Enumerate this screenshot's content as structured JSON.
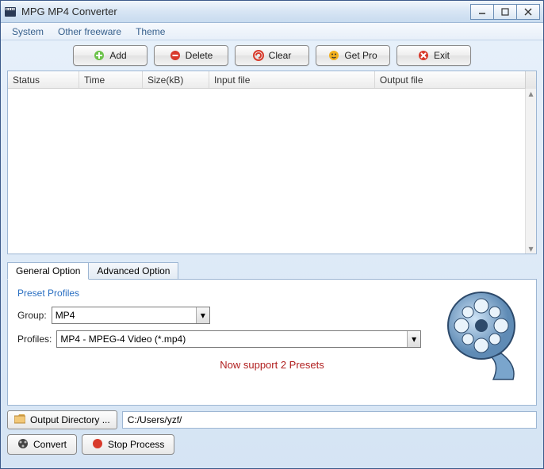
{
  "window": {
    "title": "MPG MP4 Converter"
  },
  "menu": {
    "system": "System",
    "other": "Other freeware",
    "theme": "Theme"
  },
  "toolbar": {
    "add": "Add",
    "delete": "Delete",
    "clear": "Clear",
    "getpro": "Get Pro",
    "exit": "Exit"
  },
  "table": {
    "columns": {
      "status": "Status",
      "time": "Time",
      "size": "Size(kB)",
      "input": "Input file",
      "output": "Output file"
    },
    "rows": []
  },
  "tabs": {
    "general": "General Option",
    "advanced": "Advanced Option"
  },
  "preset": {
    "legend": "Preset Profiles",
    "group_label": "Group:",
    "group_value": "MP4",
    "profiles_label": "Profiles:",
    "profiles_value": "MP4 - MPEG-4 Video (*.mp4)",
    "message": "Now support 2 Presets"
  },
  "output": {
    "button": "Output Directory ...",
    "path": "C:/Users/yzf/"
  },
  "actions": {
    "convert": "Convert",
    "stop": "Stop Process"
  }
}
